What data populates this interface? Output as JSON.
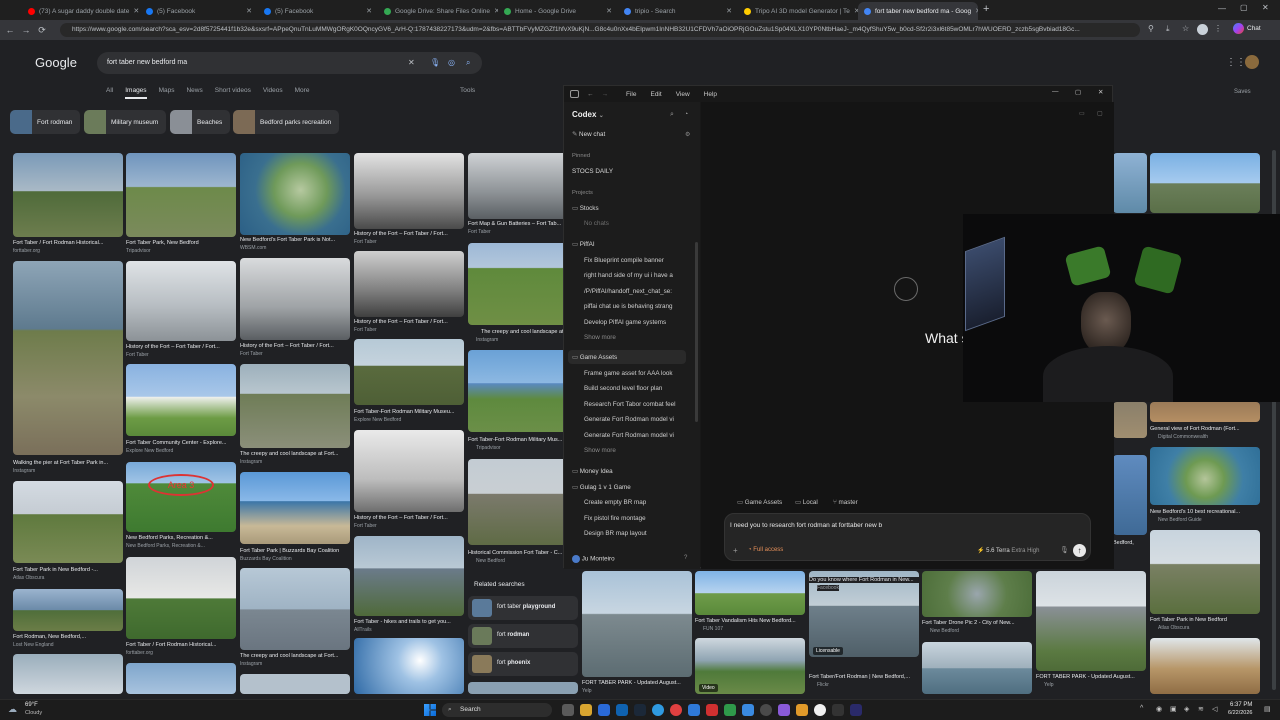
{
  "browser": {
    "tabs": [
      {
        "label": "(73) A sugar daddy double date",
        "color": "#ff0000"
      },
      {
        "label": "(5) Facebook",
        "color": "#1877f2"
      },
      {
        "label": "(5) Facebook",
        "color": "#1877f2"
      },
      {
        "label": "Google Drive: Share Files Online",
        "color": "#34a853"
      },
      {
        "label": "Home - Google Drive",
        "color": "#34a853"
      },
      {
        "label": "tripio - Search",
        "color": "#4285f4"
      },
      {
        "label": "Tripo AI 3D model Generator | Te",
        "color": "#ffcc00"
      },
      {
        "label": "fort taber new bedford ma - Goog",
        "color": "#4285f4"
      }
    ],
    "url": "https://www.google.com/search?sca_esv=2d8f5725441f1b32e&sxsrf=APpeQnuTnLuMMWgORgK0OQncyGV6_ArH-Q:1787438227173&udm=2&fbs=ABTTbFVyMZGZf1hfvX9uKjN...G8c4u0nXx4bEIpwm1InNHB32U1CFDVh7aOiOPRjGOuZstu1Sp04XLX10YP0NtbHaeJ-_m4QyfShuY5w_b0cd-Sf2r2i3xl6t85wOMLr7hWUOERD_zczb5sgBvbiad18Gc...",
    "chat_label": "Chat"
  },
  "google": {
    "logo": "Google",
    "query": "fort taber new bedford ma",
    "tabs": [
      "All",
      "Images",
      "Maps",
      "News",
      "Short videos",
      "Videos",
      "More"
    ],
    "tools_label": "Tools",
    "saves_label": "Saves",
    "chips": [
      "Fort rodman",
      "Military museum",
      "Beaches",
      "Bedford parks recreation"
    ],
    "captions": [
      {
        "title": "Fort Taber / Fort Rodman Historical...",
        "src": "forttaber.org"
      },
      {
        "title": "Fort Taber Park, New Bedford",
        "src": "Tripadvisor"
      },
      {
        "title": "New Bedford's Fort Taber Park is Not...",
        "src": "WBSM.com"
      },
      {
        "title": "History of the Fort – Fort Taber / Fort...",
        "src": "Fort Taber"
      },
      {
        "title": "Fort Map & Gun Batteries – Fort Tab...",
        "src": "Fort Taber"
      },
      {
        "title": "History of the Fort – Fort Taber / Fort...",
        "src": "Fort Taber"
      },
      {
        "title": "History of the Fort – Fort Taber / Fort...",
        "src": "Fort Taber"
      },
      {
        "title": "History of the Fort – Fort Taber / Fort...",
        "src": "Fort Taber"
      },
      {
        "title": "The creepy and cool landscape at Fo...",
        "src": "Instagram"
      },
      {
        "title": "Fort Taber Community Center - Explore...",
        "src": "Explore New Bedford"
      },
      {
        "title": "Fort Taber-Fort Rodman Military Museu...",
        "src": "Explore New Bedford"
      },
      {
        "title": "Fort Taber-Fort Rodman Military Mus...",
        "src": "Tripadvisor"
      },
      {
        "title": "Walking the pier at Fort Taber Park in...",
        "src": "Instagram"
      },
      {
        "title": "The creepy and cool landscape at Fort...",
        "src": "Instagram"
      },
      {
        "title": "New Bedford Parks, Recreation &...",
        "src": "New Bedford Parks, Recreation &..."
      },
      {
        "title": "Fort Taber Park | Buzzards Bay Coalition",
        "src": "Buzzards Bay Coalition"
      },
      {
        "title": "History of the Fort – Fort Taber / Fort...",
        "src": "Fort Taber"
      },
      {
        "title": "Historical Commission Fort Taber - C...",
        "src": "New Bedford"
      },
      {
        "title": "Fort Taber Park in New Bedford -...",
        "src": "Atlas Obscura"
      },
      {
        "title": "Fort Rodman, New Bedford,...",
        "src": "Lost New England"
      },
      {
        "title": "Fort Taber / Fort Rodman Historical...",
        "src": "forttaber.org"
      },
      {
        "title": "Fort Taber - hikes and trails to get you...",
        "src": "AllTrails"
      },
      {
        "title": "The creepy and cool landscape at Fort...",
        "src": "Instagram"
      },
      {
        "title": "General view of Fort Rodman (Fort...",
        "src": "Digital Commonwealth"
      },
      {
        "title": "New Bedford's 10 best recreational...",
        "src": "New Bedford Guide"
      },
      {
        "title": "Fort Taber Park in New Bedford",
        "src": "Atlas Obscura"
      },
      {
        "title": "Fort Taber Vandalism Hits New Bedford...",
        "src": "FUN 107"
      },
      {
        "title": "Do you know where Fort Rodman in New...",
        "src": "Facebook"
      },
      {
        "title": "Fort Taber Drone Pic 2 - City of New...",
        "src": "New Bedford"
      },
      {
        "title": "FORT TABER PARK - Updated August...",
        "src": "Yelp"
      },
      {
        "title": "FORT TABER PARK - Updated August...",
        "src": "Yelp"
      },
      {
        "title": "Fort Taber/Fort Rodman | New Bedford,...",
        "src": "Flickr"
      },
      {
        "title": "FORT TABER PARK - Updated August...",
        "src": "Yelp"
      }
    ],
    "image_badges": {
      "area3": "Area 3",
      "licensable": "Licensable",
      "video": "Video",
      "bedford": "Bedford,"
    },
    "related": {
      "title": "Related searches",
      "items": [
        {
          "prefix": "fort taber ",
          "bold": "playground"
        },
        {
          "prefix": "fort ",
          "bold": "rodman"
        },
        {
          "prefix": "fort ",
          "bold": "phoenix"
        }
      ]
    }
  },
  "codex": {
    "menu": [
      "File",
      "Edit",
      "View",
      "Help"
    ],
    "app_name": "Codex",
    "new_chat": "New chat",
    "pinned_label": "Pinned",
    "pinned_item": "STOCS DAILY",
    "projects_label": "Projects",
    "stocks": {
      "name": "Stocks",
      "empty": "No chats"
    },
    "piffai": {
      "name": "PiffAI",
      "items": [
        "Fix Blueprint compile banner",
        "right hand side of my ui i have a",
        "/P/PiffAI/handoff_next_chat_se:",
        "piffai chat ue is behaving strang",
        "Develop PiffAI game systems"
      ],
      "more": "Show more"
    },
    "game_assets": {
      "name": "Game Assets",
      "items": [
        "Frame game asset for AAA look",
        "Build second level floor plan",
        "Research Fort Tabor combat feel",
        "Generate Fort Rodman model vi",
        "Generate Fort Rodman model vi"
      ],
      "more": "Show more"
    },
    "money_idea": {
      "name": "Money Idea"
    },
    "gulag": {
      "name": "Gulag 1 v 1 Game",
      "items": [
        "Create empty BR map",
        "Fix pistol fire montage",
        "Design BR map layout"
      ]
    },
    "user": "Ju Monteiro",
    "hero": "What should we build in Gam",
    "context": {
      "project": "Game Assets",
      "env": "Local",
      "branch": "master"
    },
    "input_text": "I need you to research fort rodman at forttaber new b",
    "access": "Full access",
    "model": "5.6 Terra",
    "effort": "Extra High"
  },
  "taskbar": {
    "weather_temp": "69°F",
    "weather_cond": "Cloudy",
    "search_label": "Search",
    "time": "6:37 PM",
    "date": "6/22/2026"
  }
}
